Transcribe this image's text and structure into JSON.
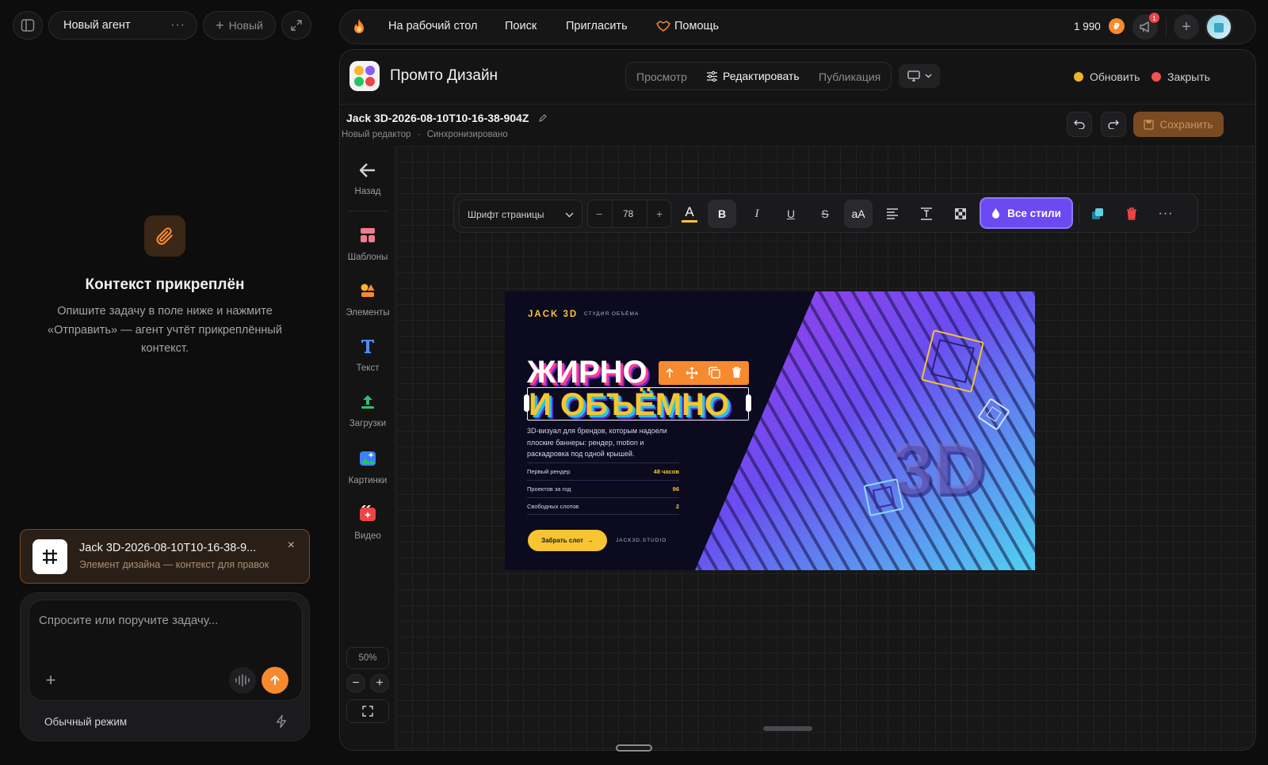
{
  "left_panel": {
    "agent_name": "Новый агент",
    "new_button": "Новый",
    "context_title": "Контекст прикреплён",
    "context_desc": "Опишите задачу в поле ниже и нажмите «Отправить» — агент учтёт прикреплённый контекст.",
    "attachment": {
      "title": "Jack 3D-2026-08-10T10-16-38-9...",
      "subtitle": "Элемент дизайна — контекст для правок"
    },
    "chat": {
      "placeholder": "Спросите или поручите задачу...",
      "mode_label": "Обычный режим"
    }
  },
  "top_bar": {
    "desktop_link": "На рабочий стол",
    "search_link": "Поиск",
    "invite_link": "Пригласить",
    "help_link": "Помощь",
    "balance": "1 990",
    "notifications_count": "1"
  },
  "editor": {
    "app_title": "Промто Дизайн",
    "tabs": {
      "view": "Просмотр",
      "edit": "Редактировать",
      "publish": "Публикация"
    },
    "refresh_label": "Обновить",
    "close_label": "Закрыть",
    "doc_title": "Jack 3D-2026-08-10T10-16-38-904Z",
    "doc_sub_editor": "Новый редактор",
    "doc_sub_sep": "·",
    "doc_sub_status": "Синхронизировано",
    "save_label": "Сохранить",
    "colors": {
      "accent_orange": "#f7892f",
      "accent_purple": "#6c4af2",
      "refresh_dot": "#f0b429",
      "close_dot": "#ef5350"
    }
  },
  "rail": {
    "back": "Назад",
    "templates": "Шаблоны",
    "elements": "Элементы",
    "text": "Текст",
    "uploads": "Загрузки",
    "images": "Картинки",
    "video": "Видео",
    "zoom": "50%"
  },
  "format_bar": {
    "font_name": "Шрифт страницы",
    "font_size": "78",
    "minus": "−",
    "plus": "+",
    "color_letter": "A",
    "bold": "B",
    "italic": "I",
    "underline": "U",
    "strike": "S",
    "case": "aA",
    "all_styles": "Все стили"
  },
  "artwork": {
    "brand": "JACK 3D",
    "brand_sub": "СТУДИЯ ОБЪЁМА",
    "headline1": "ЖИРНО",
    "headline2": "И ОБЪЁМНО",
    "desc": "3D-визуал для брендов, которым надоели плоские баннеры: рендер, motion и раскадровка под одной крышей.",
    "stats": [
      {
        "label": "Первый рендер",
        "value": "48 часов"
      },
      {
        "label": "Проектов за год",
        "value": "96"
      },
      {
        "label": "Свободных слотов",
        "value": "2"
      }
    ],
    "cta": "Забрать слот",
    "site": "JACK3D.STUDIO",
    "big_text": "3D"
  }
}
